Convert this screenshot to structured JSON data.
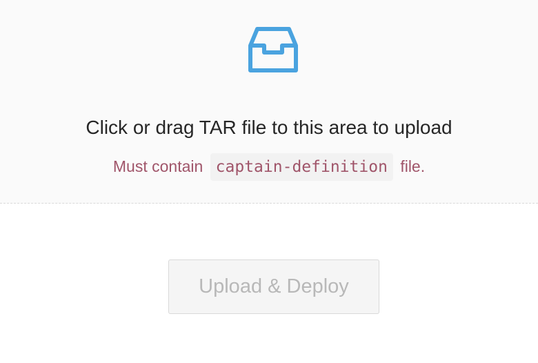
{
  "dropzone": {
    "icon": "inbox-icon",
    "title": "Click or drag TAR file to this area to upload",
    "hint_prefix": "Must contain",
    "hint_code": "captain-definition",
    "hint_suffix": "file."
  },
  "actions": {
    "deploy_label": "Upload & Deploy",
    "deploy_enabled": false
  },
  "colors": {
    "icon": "#4aa3df",
    "hint": "#a0556a",
    "disabled_text": "#b8b8b8"
  }
}
